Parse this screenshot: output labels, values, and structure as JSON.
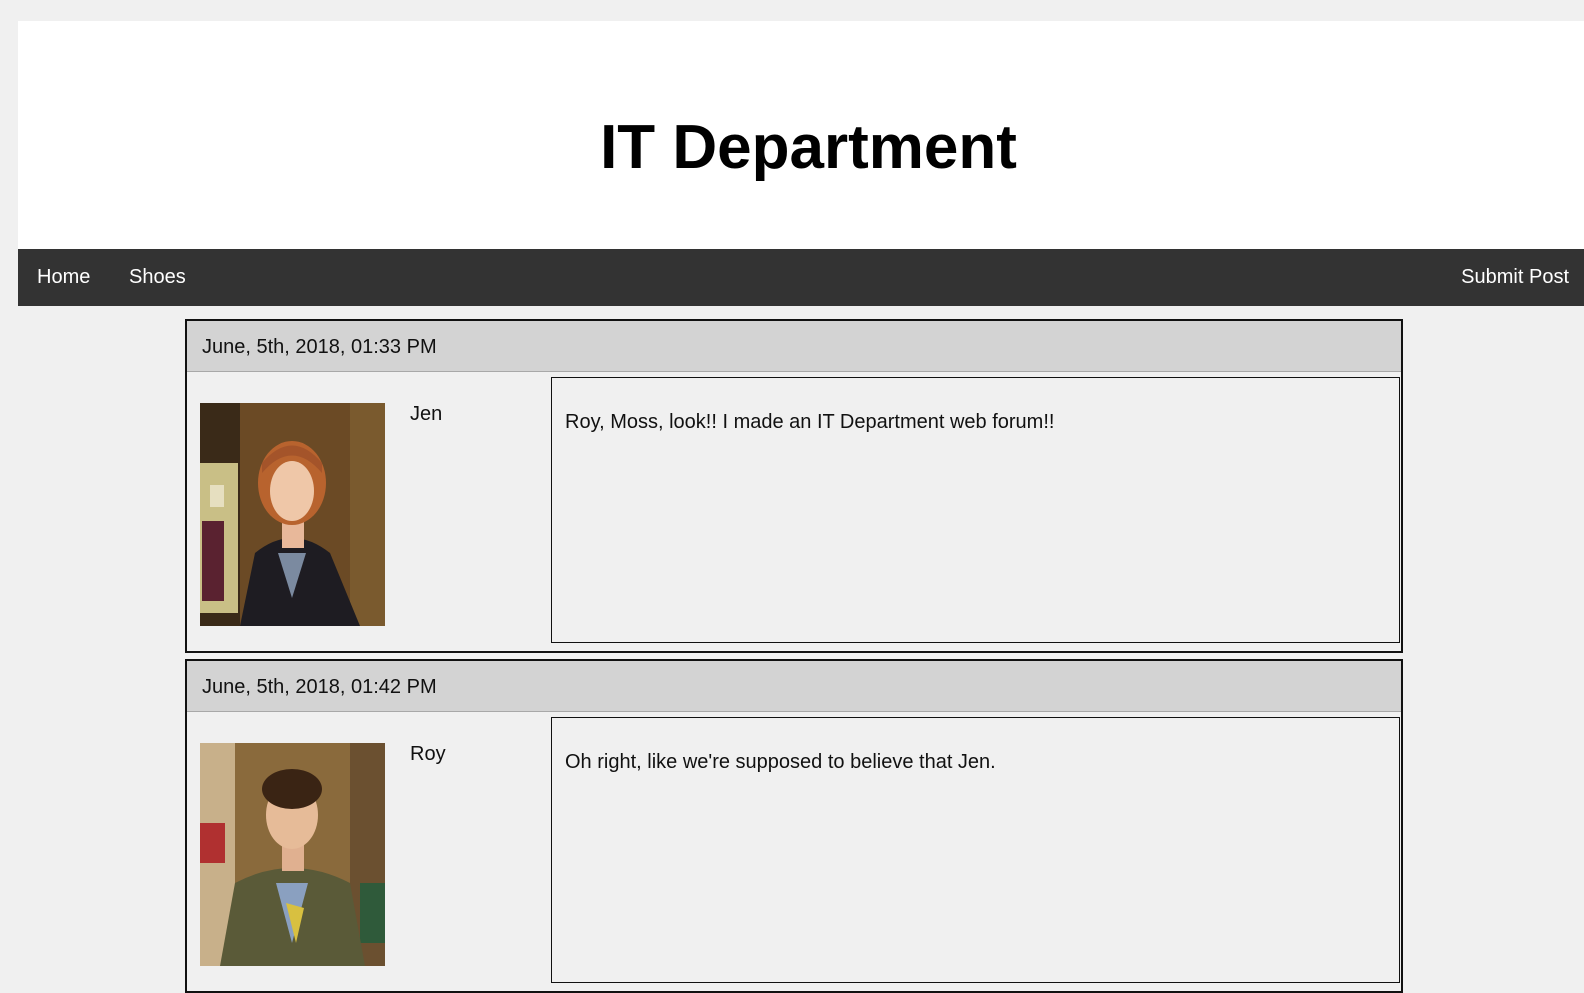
{
  "site": {
    "title": "IT Department"
  },
  "nav": {
    "home": "Home",
    "shoes": "Shoes",
    "submit_post": "Submit Post"
  },
  "posts": [
    {
      "date": "June, 5th, 2018, 01:33 PM",
      "author": "Jen",
      "body": "Roy, Moss, look!! I made an IT Department web forum!!"
    },
    {
      "date": "June, 5th, 2018, 01:42 PM",
      "author": "Roy",
      "body": "Oh right, like we're supposed to believe that Jen."
    }
  ],
  "colors": {
    "navbar_bg": "#333333",
    "post_header_bg": "#d3d3d3",
    "page_bg": "#f0f0f0"
  }
}
